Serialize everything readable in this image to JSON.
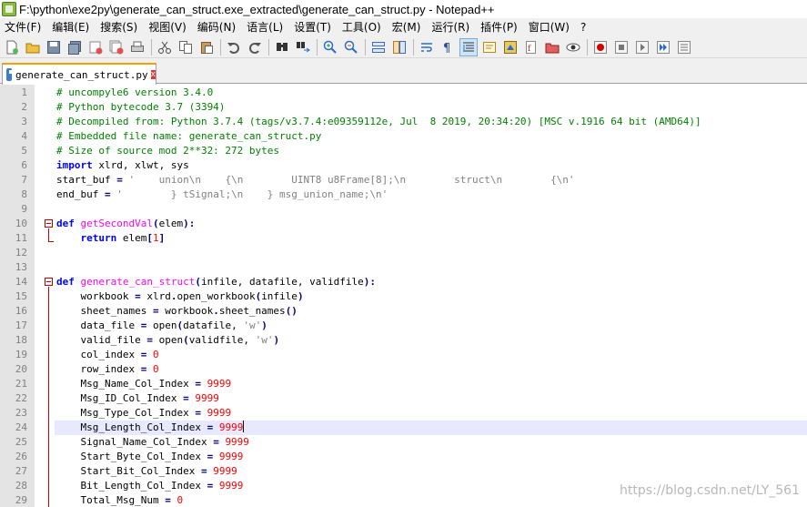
{
  "window": {
    "title": "F:\\python\\exe2py\\generate_can_struct.exe_extracted\\generate_can_struct.py - Notepad++"
  },
  "menu": {
    "items": [
      "文件(F)",
      "编辑(E)",
      "搜索(S)",
      "视图(V)",
      "编码(N)",
      "语言(L)",
      "设置(T)",
      "工具(O)",
      "宏(M)",
      "运行(R)",
      "插件(P)",
      "窗口(W)",
      "?"
    ]
  },
  "toolbar": {
    "icons": [
      "new-file-icon",
      "open-file-icon",
      "save-icon",
      "save-all-icon",
      "close-icon",
      "close-all-icon",
      "print-icon",
      "cut-icon",
      "copy-icon",
      "paste-icon",
      "undo-icon",
      "redo-icon",
      "find-icon",
      "replace-icon",
      "zoom-in-icon",
      "zoom-out-icon",
      "sync-vertical-icon",
      "sync-horizontal-icon",
      "word-wrap-icon",
      "show-all-chars-icon",
      "indent-guide-icon",
      "user-defined-language-icon",
      "doc-map-icon",
      "function-list-icon",
      "folder-workspace-icon",
      "monitoring-icon",
      "record-macro-icon",
      "stop-record-icon",
      "play-macro-icon",
      "run-macro-multiple-icon",
      "save-macro-icon"
    ]
  },
  "tab": {
    "label": "generate_can_struct.py",
    "close": "x"
  },
  "editor": {
    "current_line": 24,
    "lines": [
      {
        "n": "1",
        "tokens": [
          [
            "c-com",
            "# uncompyle6 version 3.4.0"
          ]
        ]
      },
      {
        "n": "2",
        "tokens": [
          [
            "c-com",
            "# Python bytecode 3.7 (3394)"
          ]
        ]
      },
      {
        "n": "3",
        "tokens": [
          [
            "c-com",
            "# Decompiled from: Python 3.7.4 (tags/v3.7.4:e09359112e, Jul  8 2019, 20:34:20) [MSC v.1916 64 bit (AMD64)]"
          ]
        ]
      },
      {
        "n": "4",
        "tokens": [
          [
            "c-com",
            "# Embedded file name: generate_can_struct.py"
          ]
        ]
      },
      {
        "n": "5",
        "tokens": [
          [
            "c-com",
            "# Size of source mod 2**32: 272 bytes"
          ]
        ]
      },
      {
        "n": "6",
        "tokens": [
          [
            "c-kw",
            "import"
          ],
          [
            "c-id",
            " xlrd, xlwt, sys"
          ]
        ]
      },
      {
        "n": "7",
        "tokens": [
          [
            "c-id",
            "start_buf "
          ],
          [
            "c-op",
            "="
          ],
          [
            "c-id",
            " "
          ],
          [
            "c-str",
            "'    union\\n    {\\n        UINT8 u8Frame[8];\\n        struct\\n        {\\n'"
          ]
        ]
      },
      {
        "n": "8",
        "tokens": [
          [
            "c-id",
            "end_buf "
          ],
          [
            "c-op",
            "="
          ],
          [
            "c-id",
            " "
          ],
          [
            "c-str",
            "'        } tSignal;\\n    } msg_union_name;\\n'"
          ]
        ]
      },
      {
        "n": "9",
        "tokens": []
      },
      {
        "n": "10",
        "tokens": [
          [
            "c-def",
            "def"
          ],
          [
            "c-id",
            " "
          ],
          [
            "c-fn",
            "getSecondVal"
          ],
          [
            "c-op",
            "("
          ],
          [
            "c-id",
            "elem"
          ],
          [
            "c-op",
            "):"
          ]
        ]
      },
      {
        "n": "11",
        "tokens": [
          [
            "c-id",
            "    "
          ],
          [
            "c-kw",
            "return"
          ],
          [
            "c-id",
            " elem"
          ],
          [
            "c-op",
            "["
          ],
          [
            "c-num",
            "1"
          ],
          [
            "c-op",
            "]"
          ]
        ]
      },
      {
        "n": "12",
        "tokens": []
      },
      {
        "n": "13",
        "tokens": []
      },
      {
        "n": "14",
        "tokens": [
          [
            "c-def",
            "def"
          ],
          [
            "c-id",
            " "
          ],
          [
            "c-fn",
            "generate_can_struct"
          ],
          [
            "c-op",
            "("
          ],
          [
            "c-id",
            "infile, datafile, validfile"
          ],
          [
            "c-op",
            "):"
          ]
        ]
      },
      {
        "n": "15",
        "tokens": [
          [
            "c-id",
            "    workbook "
          ],
          [
            "c-op",
            "="
          ],
          [
            "c-id",
            " xlrd"
          ],
          [
            "c-op",
            "."
          ],
          [
            "c-id",
            "open_workbook"
          ],
          [
            "c-op",
            "("
          ],
          [
            "c-id",
            "infile"
          ],
          [
            "c-op",
            ")"
          ]
        ]
      },
      {
        "n": "16",
        "tokens": [
          [
            "c-id",
            "    sheet_names "
          ],
          [
            "c-op",
            "="
          ],
          [
            "c-id",
            " workbook"
          ],
          [
            "c-op",
            "."
          ],
          [
            "c-id",
            "sheet_names"
          ],
          [
            "c-op",
            "()"
          ]
        ]
      },
      {
        "n": "17",
        "tokens": [
          [
            "c-id",
            "    data_file "
          ],
          [
            "c-op",
            "="
          ],
          [
            "c-id",
            " open"
          ],
          [
            "c-op",
            "("
          ],
          [
            "c-id",
            "datafile, "
          ],
          [
            "c-str",
            "'w'"
          ],
          [
            "c-op",
            ")"
          ]
        ]
      },
      {
        "n": "18",
        "tokens": [
          [
            "c-id",
            "    valid_file "
          ],
          [
            "c-op",
            "="
          ],
          [
            "c-id",
            " open"
          ],
          [
            "c-op",
            "("
          ],
          [
            "c-id",
            "validfile, "
          ],
          [
            "c-str",
            "'w'"
          ],
          [
            "c-op",
            ")"
          ]
        ]
      },
      {
        "n": "19",
        "tokens": [
          [
            "c-id",
            "    col_index "
          ],
          [
            "c-op",
            "="
          ],
          [
            "c-id",
            " "
          ],
          [
            "c-num",
            "0"
          ]
        ]
      },
      {
        "n": "20",
        "tokens": [
          [
            "c-id",
            "    row_index "
          ],
          [
            "c-op",
            "="
          ],
          [
            "c-id",
            " "
          ],
          [
            "c-num",
            "0"
          ]
        ]
      },
      {
        "n": "21",
        "tokens": [
          [
            "c-id",
            "    Msg_Name_Col_Index "
          ],
          [
            "c-op",
            "="
          ],
          [
            "c-id",
            " "
          ],
          [
            "c-num",
            "9999"
          ]
        ]
      },
      {
        "n": "22",
        "tokens": [
          [
            "c-id",
            "    Msg_ID_Col_Index "
          ],
          [
            "c-op",
            "="
          ],
          [
            "c-id",
            " "
          ],
          [
            "c-num",
            "9999"
          ]
        ]
      },
      {
        "n": "23",
        "tokens": [
          [
            "c-id",
            "    Msg_Type_Col_Index "
          ],
          [
            "c-op",
            "="
          ],
          [
            "c-id",
            " "
          ],
          [
            "c-num",
            "9999"
          ]
        ]
      },
      {
        "n": "24",
        "tokens": [
          [
            "c-id",
            "    Msg_Length_Col_Index "
          ],
          [
            "c-op",
            "="
          ],
          [
            "c-id",
            " "
          ],
          [
            "c-num",
            "9999"
          ]
        ]
      },
      {
        "n": "25",
        "tokens": [
          [
            "c-id",
            "    Signal_Name_Col_Index "
          ],
          [
            "c-op",
            "="
          ],
          [
            "c-id",
            " "
          ],
          [
            "c-num",
            "9999"
          ]
        ]
      },
      {
        "n": "26",
        "tokens": [
          [
            "c-id",
            "    Start_Byte_Col_Index "
          ],
          [
            "c-op",
            "="
          ],
          [
            "c-id",
            " "
          ],
          [
            "c-num",
            "9999"
          ]
        ]
      },
      {
        "n": "27",
        "tokens": [
          [
            "c-id",
            "    Start_Bit_Col_Index "
          ],
          [
            "c-op",
            "="
          ],
          [
            "c-id",
            " "
          ],
          [
            "c-num",
            "9999"
          ]
        ]
      },
      {
        "n": "28",
        "tokens": [
          [
            "c-id",
            "    Bit_Length_Col_Index "
          ],
          [
            "c-op",
            "="
          ],
          [
            "c-id",
            " "
          ],
          [
            "c-num",
            "9999"
          ]
        ]
      },
      {
        "n": "29",
        "tokens": [
          [
            "c-id",
            "    Total_Msg_Num "
          ],
          [
            "c-op",
            "="
          ],
          [
            "c-id",
            " "
          ],
          [
            "c-num",
            "0"
          ]
        ]
      }
    ]
  },
  "watermark": "https://blog.csdn.net/LY_561"
}
